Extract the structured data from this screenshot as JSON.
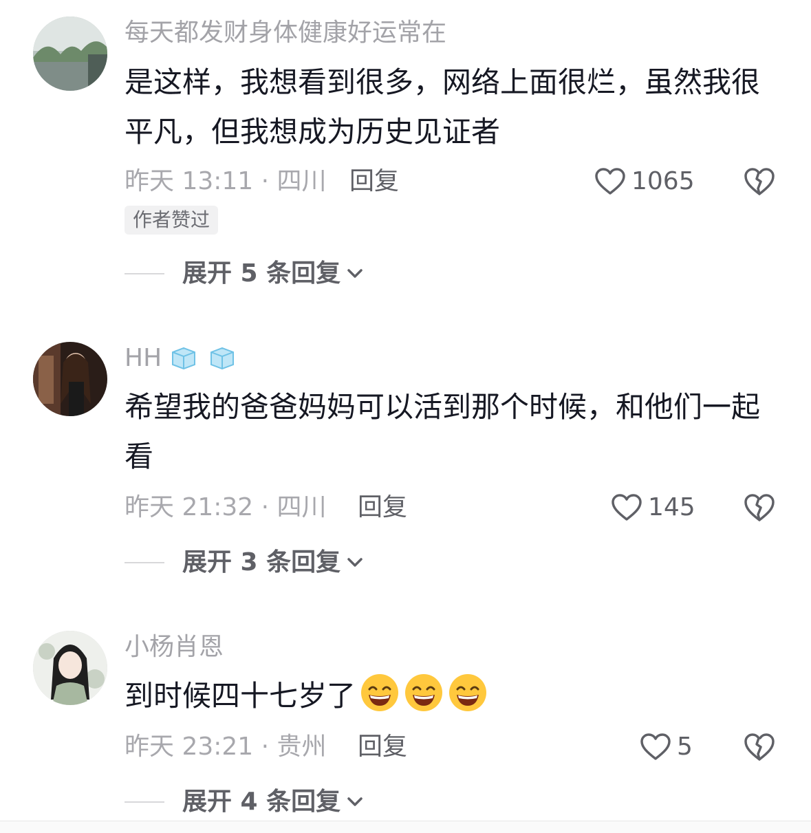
{
  "comments": [
    {
      "username": "每天都发财身体健康好运常在",
      "text": "是这样，我想看到很多，网络上面很烂，虽然我很平凡，但我想成为历史见证者",
      "time": "昨天 13:11 · 四川",
      "reply_label": "回复",
      "likes": "1065",
      "author_tag": "作者赞过",
      "expand_label": "展开 5 条回复"
    },
    {
      "username": "HH",
      "text": "希望我的爸爸妈妈可以活到那个时候，和他们一起看",
      "time": "昨天 21:32 · 四川",
      "reply_label": "回复",
      "likes": "145",
      "expand_label": "展开 3 条回复"
    },
    {
      "username": "小杨肖恩",
      "text": "到时候四十七岁了",
      "emoji_count": 3,
      "time": "昨天 23:21 · 贵州",
      "reply_label": "回复",
      "likes": "5",
      "expand_label": "展开 4 条回复"
    }
  ],
  "icons": {
    "like": "heart-outline-icon",
    "dislike": "broken-heart-icon",
    "expand": "chevron-down-icon",
    "badge": "ice-cube-icon",
    "emoji": "grinning-face-emoji"
  },
  "colors": {
    "text": "#161823",
    "meta": "#a8a8ad",
    "action": "#5f6066"
  }
}
